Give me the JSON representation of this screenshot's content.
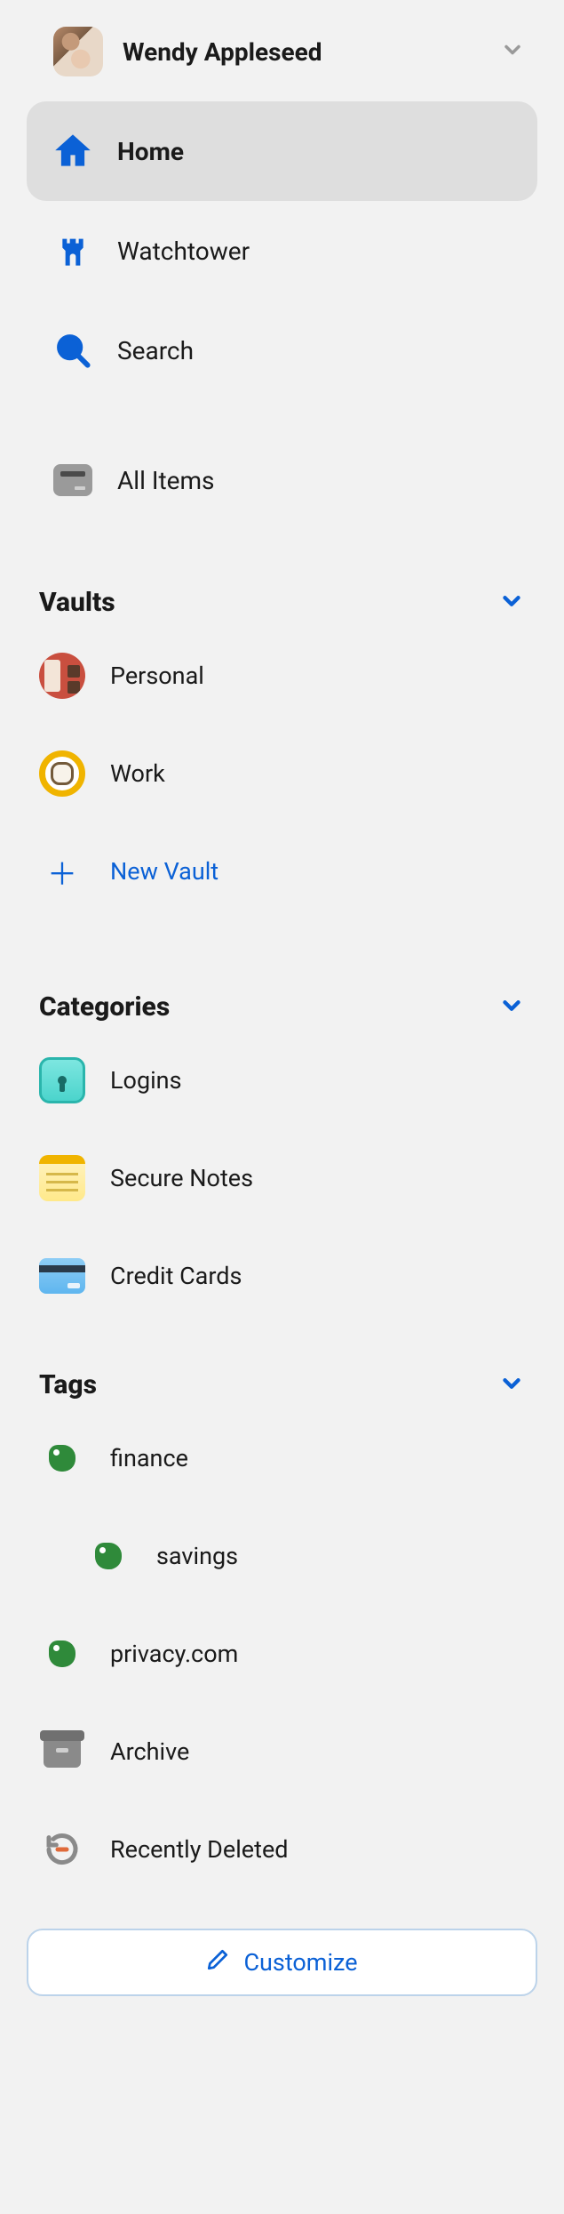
{
  "user": {
    "name": "Wendy Appleseed"
  },
  "nav": {
    "home": "Home",
    "watchtower": "Watchtower",
    "search": "Search",
    "all_items": "All Items"
  },
  "sections": {
    "vaults": {
      "title": "Vaults",
      "items": [
        {
          "label": "Personal"
        },
        {
          "label": "Work"
        }
      ],
      "new_vault": "New Vault"
    },
    "categories": {
      "title": "Categories",
      "items": [
        {
          "label": "Logins"
        },
        {
          "label": "Secure Notes"
        },
        {
          "label": "Credit Cards"
        }
      ]
    },
    "tags": {
      "title": "Tags",
      "items": [
        {
          "label": "finance"
        },
        {
          "label": "savings"
        },
        {
          "label": "privacy.com"
        }
      ]
    }
  },
  "footer_items": {
    "archive": "Archive",
    "recently_deleted": "Recently Deleted"
  },
  "customize": "Customize",
  "colors": {
    "accent": "#0b61d6"
  }
}
